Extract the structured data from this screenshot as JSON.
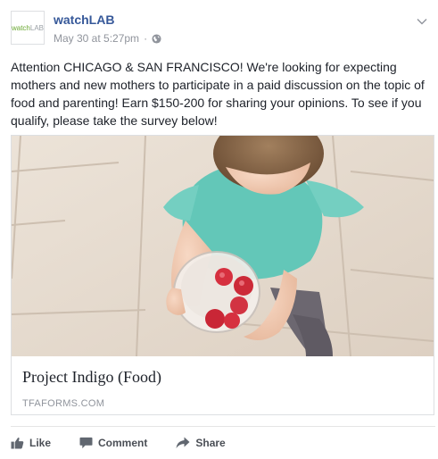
{
  "post": {
    "page_name": "watchLAB",
    "avatar_logo_text": {
      "part1": "watch",
      "part2": "LAB"
    },
    "timestamp": "May 30 at 5:27pm",
    "separator": "·",
    "privacy_icon": "globe-icon",
    "menu_icon": "chevron-down-icon",
    "text": "Attention CHICAGO & SAN FRANCISCO! We're looking for expecting mothers and new mothers to participate in a paid discussion on the topic of food and parenting! Earn $150-200 for sharing your opinions. To see if you qualify, please take the survey below!"
  },
  "link_card": {
    "title": "Project Indigo (Food)",
    "domain": "TFAFORMS.COM",
    "image_description_icon": "photo-child-with-raspberries"
  },
  "actions": [
    {
      "label": "Like",
      "icon": "thumbs-up-icon"
    },
    {
      "label": "Comment",
      "icon": "comment-icon"
    },
    {
      "label": "Share",
      "icon": "share-icon"
    }
  ],
  "colors": {
    "link_blue": "#365899",
    "meta_gray": "#90949c",
    "action_gray": "#4b4f56",
    "logo_green": "#6aa832"
  }
}
